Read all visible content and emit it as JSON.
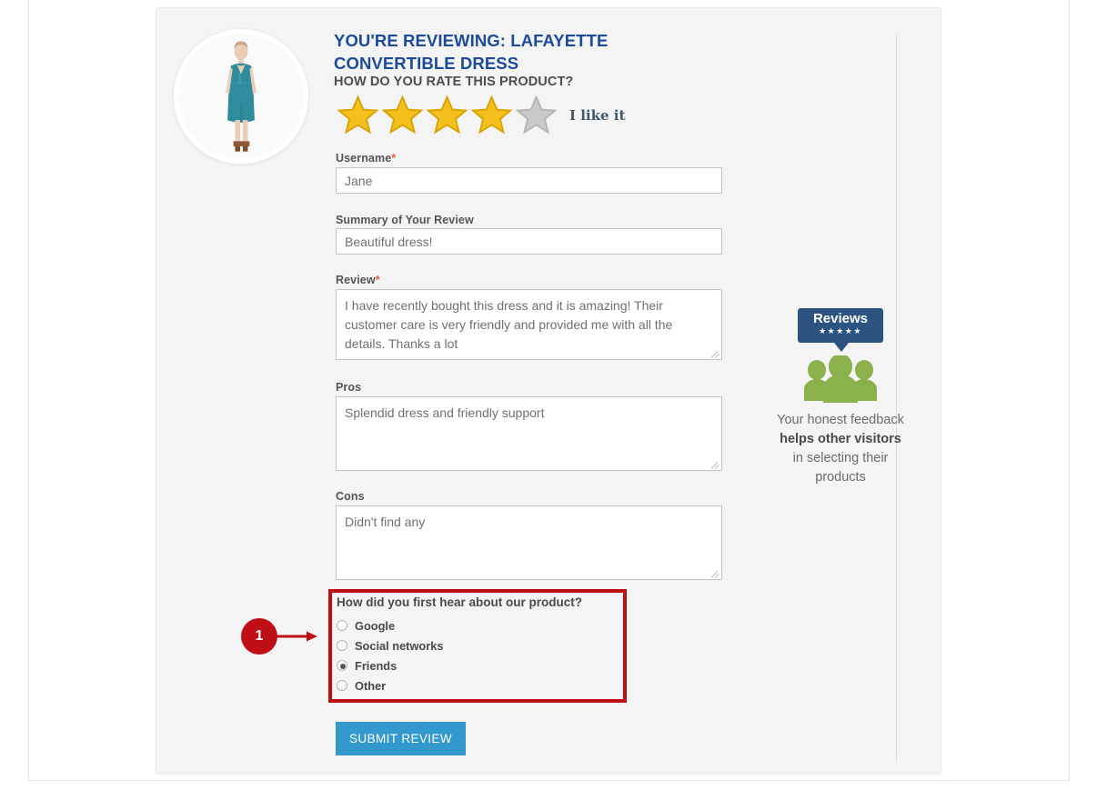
{
  "product": {
    "thumbnail_alt": "Lafayette Convertible Dress - teal sleeveless dress on model"
  },
  "header": {
    "title": "YOU'RE REVIEWING: LAFAYETTE CONVERTIBLE DRESS",
    "rate_question": "HOW DO YOU RATE THIS PRODUCT?"
  },
  "rating": {
    "value": 4,
    "max": 5,
    "label": "I like it",
    "star_filled_color": "#f5c01e",
    "star_empty_color": "#c9c9c9"
  },
  "form": {
    "username": {
      "label": "Username",
      "required_marker": "*",
      "value": "Jane",
      "placeholder": "Username"
    },
    "summary": {
      "label": "Summary of Your Review",
      "value": "Beautiful dress!",
      "placeholder": "Summary of Your Review"
    },
    "review": {
      "label": "Review",
      "required_marker": "*",
      "value": "I have recently bought this dress and it is amazing! Their customer care is very friendly and provided me with all the details. Thanks a lot",
      "placeholder": "Review"
    },
    "pros": {
      "label": "Pros",
      "value": "Splendid dress and friendly support",
      "placeholder": "Pros"
    },
    "cons": {
      "label": "Cons",
      "value": "Didn't find any",
      "placeholder": "Cons"
    },
    "source_question": {
      "legend": "How did you first hear about our product?",
      "selected": "Friends",
      "options": [
        {
          "label": "Google",
          "checked": false
        },
        {
          "label": "Social networks",
          "checked": false
        },
        {
          "label": "Friends",
          "checked": true
        },
        {
          "label": "Other",
          "checked": false
        }
      ],
      "highlight_color": "#bf0f16"
    },
    "submit_label": "SUBMIT REVIEW",
    "submit_color": "#3399cc"
  },
  "annotation": {
    "badge_number": "1",
    "badge_color": "#bf0f16"
  },
  "sidebar": {
    "badge_title": "Reviews",
    "badge_stars": "★★★★★",
    "badge_color": "#2d5481",
    "people_icon_color": "#8ab14b",
    "line1": "Your honest feedback",
    "line2": "helps other visitors",
    "line3": "in selecting their",
    "line4": "products"
  }
}
